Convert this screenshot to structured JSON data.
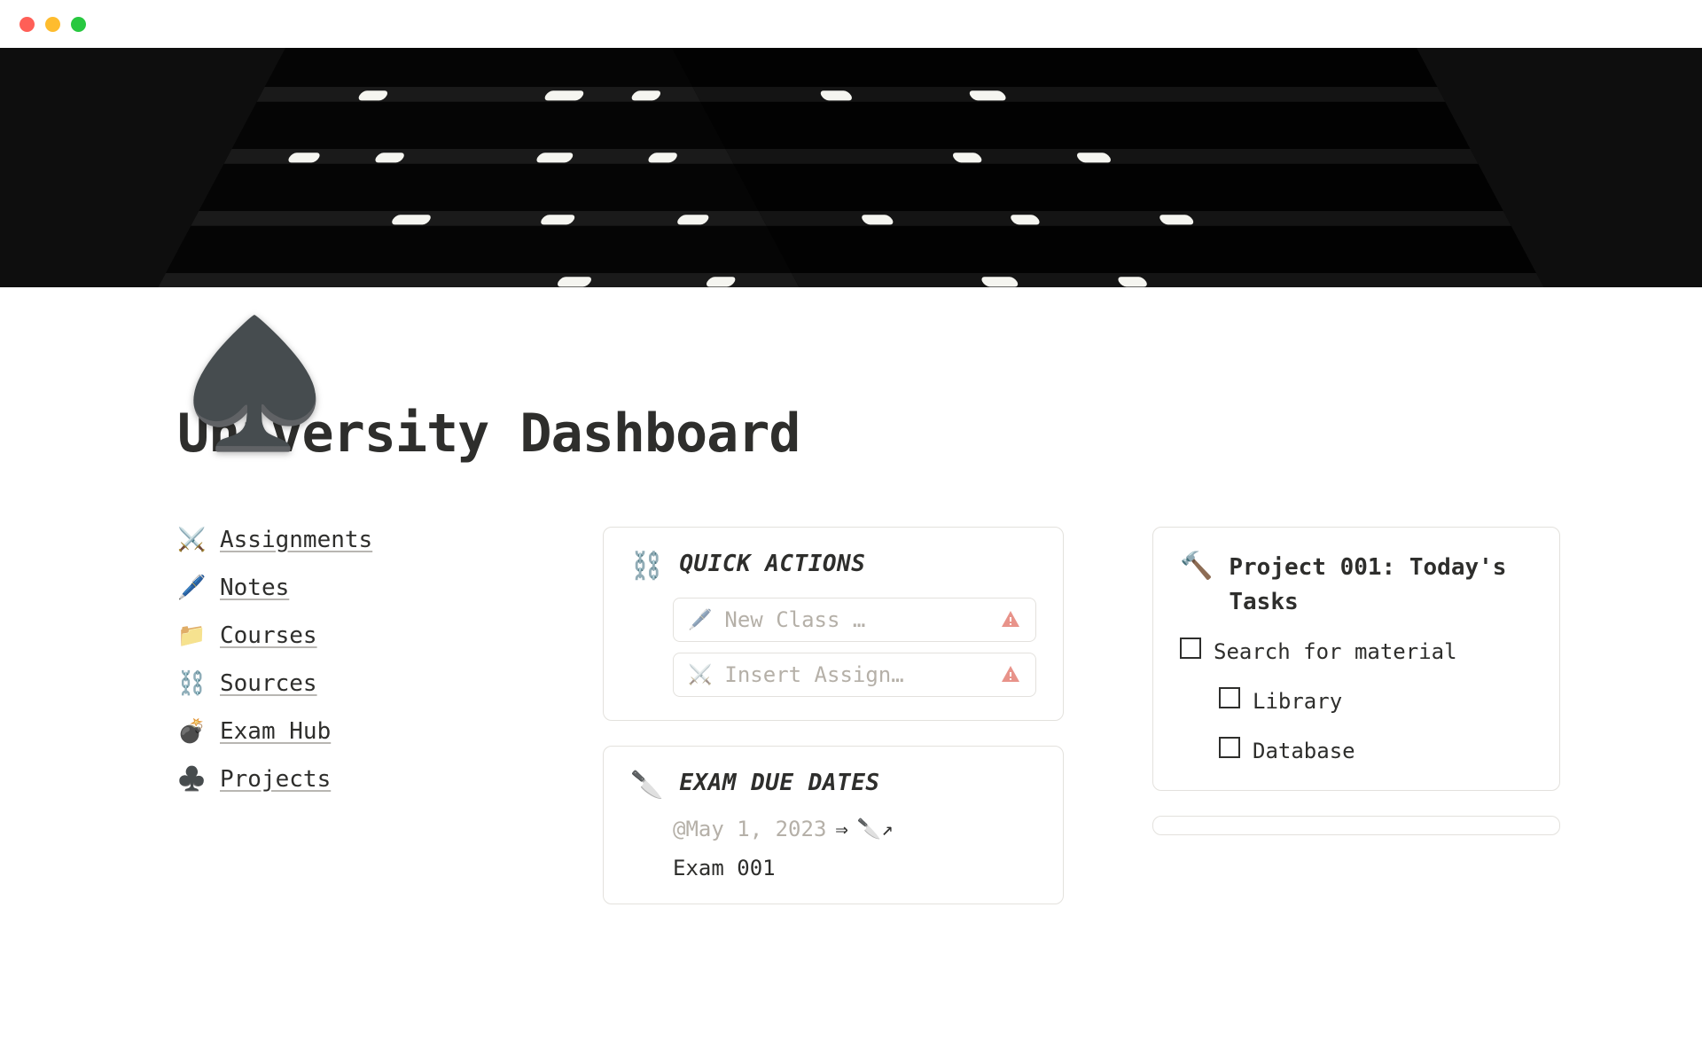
{
  "page": {
    "icon": "♠️",
    "title": "University Dashboard"
  },
  "nav": [
    {
      "icon": "⚔️",
      "label": "Assignments"
    },
    {
      "icon": "🖊️",
      "label": "Notes"
    },
    {
      "icon": "📁",
      "label": "Courses"
    },
    {
      "icon": "⛓️",
      "label": "Sources"
    },
    {
      "icon": "💣",
      "label": "Exam Hub"
    },
    {
      "icon": "♣️",
      "label": "Projects"
    }
  ],
  "quick_actions": {
    "icon": "⛓️",
    "title": "QUICK ACTIONS",
    "items": [
      {
        "icon": "🖊️",
        "label": "New Class …"
      },
      {
        "icon": "⚔️",
        "label": "Insert Assign…"
      }
    ]
  },
  "exam_due": {
    "icon": "🔪",
    "title": "EXAM DUE DATES",
    "date": "@May 1, 2023",
    "arrow": "⇒",
    "link_icon": "🔪↗",
    "exam_name": "Exam 001"
  },
  "project": {
    "icon": "🔨",
    "title": "Project 001: Today's Tasks",
    "tasks": [
      {
        "label": "Search for material",
        "indent": 0
      },
      {
        "label": "Library",
        "indent": 1
      },
      {
        "label": "Database",
        "indent": 1
      }
    ]
  }
}
